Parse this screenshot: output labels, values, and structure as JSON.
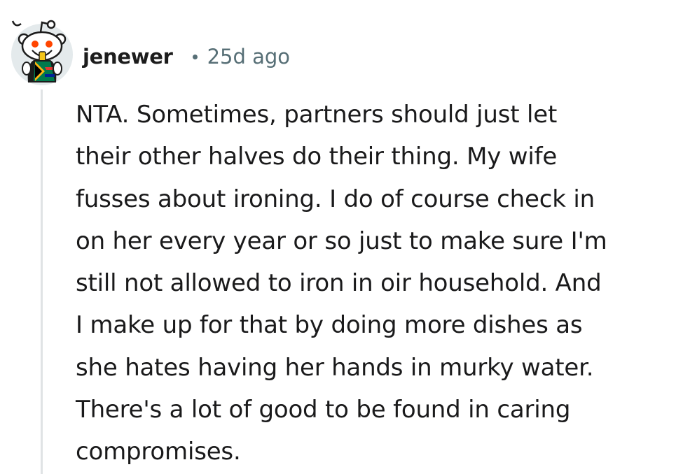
{
  "comment": {
    "author": "jenewer",
    "separator": "•",
    "timestamp": "25d ago",
    "avatar_icon": "snoo-avatar-icon",
    "body_lines": [
      "NTA. Sometimes, partners should just let",
      "their other halves do their thing. My wife",
      "fusses about ironing. I do of course check in",
      "on her every year or so just to make sure I'm",
      "still not allowed to iron in oir household. And",
      "I make up for that by doing more dishes as",
      "she hates having her hands in murky water.",
      "There's a lot of good to be found in caring",
      "compromises."
    ]
  },
  "colors": {
    "text": "#1a1a1b",
    "meta": "#576f76",
    "thread_line": "#e0e3e5",
    "avatar_bg": "#e4eaec"
  }
}
